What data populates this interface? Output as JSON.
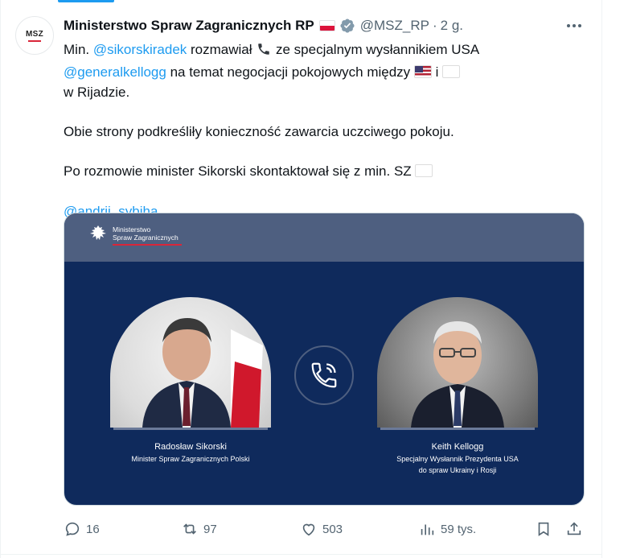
{
  "account": {
    "avatar_text": "MSZ",
    "display_name": "Ministerstwo Spraw Zagranicznych RP",
    "handle": "@MSZ_RP",
    "separator": "·",
    "time": "2 g."
  },
  "tweet": {
    "p1": {
      "t1": "Min. ",
      "mention1": "@sikorskiradek",
      "t2": " rozmawiał ",
      "t3": " ze specjalnym wysłannikiem USA ",
      "mention2": "@generalkellogg",
      "t4": " na temat negocjacji pokojowych między ",
      "t5": " i ",
      "t6": " w Rijadzie."
    },
    "p2": "Obie strony podkreśliły konieczność zawarcia uczciwego pokoju.",
    "p3": {
      "t1": "Po rozmowie minister Sikorski skontaktował się z min. SZ ",
      "mention": "@andrii_sybiha",
      "t2": "."
    }
  },
  "media": {
    "ministry_line1": "Ministerstwo",
    "ministry_line2": "Spraw Zagranicznych",
    "left_name": "Radosław Sikorski",
    "left_role": "Minister Spraw Zagranicznych Polski",
    "right_name": "Keith Kellogg",
    "right_role_line1": "Specjalny Wysłannik Prezydenta USA",
    "right_role_line2": "do spraw Ukrainy i Rosji",
    "colors": {
      "background": "#0f2a5c",
      "header": "#4e5f80",
      "accent_red": "#d9263a"
    }
  },
  "actions": {
    "replies": "16",
    "reposts": "97",
    "likes": "503",
    "views": "59 tys."
  },
  "colors": {
    "link": "#1d9bf0",
    "muted": "#536471",
    "text": "#0f1419"
  }
}
